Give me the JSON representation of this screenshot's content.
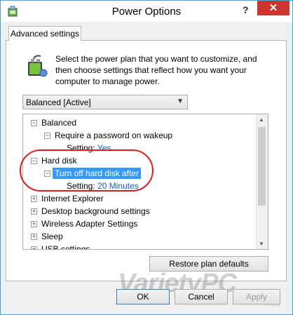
{
  "window": {
    "title": "Power Options",
    "help_label": "?",
    "close_label": "✕"
  },
  "tab": {
    "label": "Advanced settings"
  },
  "description": "Select the power plan that you want to customize, and then choose settings that reflect how you want your computer to manage power.",
  "plan_dropdown": {
    "selected": "Balanced [Active]"
  },
  "tree": {
    "balanced": {
      "label": "Balanced",
      "child_label": "Require a password on wakeup",
      "setting_label": "Setting:",
      "setting_value": "Yes"
    },
    "hard_disk": {
      "label": "Hard disk",
      "child_label": "Turn off hard disk after",
      "setting_label": "Setting:",
      "setting_value": "20 Minutes"
    },
    "collapsed_items": [
      "Internet Explorer",
      "Desktop background settings",
      "Wireless Adapter Settings",
      "Sleep",
      "USB settings"
    ]
  },
  "buttons": {
    "restore": "Restore plan defaults",
    "ok": "OK",
    "cancel": "Cancel",
    "apply": "Apply"
  },
  "watermark": {
    "text": "VarietyPC",
    "suffix": ".net"
  },
  "colors": {
    "selection": "#3399ff",
    "link": "#0066cc",
    "close_button": "#c7372f",
    "highlight_circle": "#d62020"
  }
}
